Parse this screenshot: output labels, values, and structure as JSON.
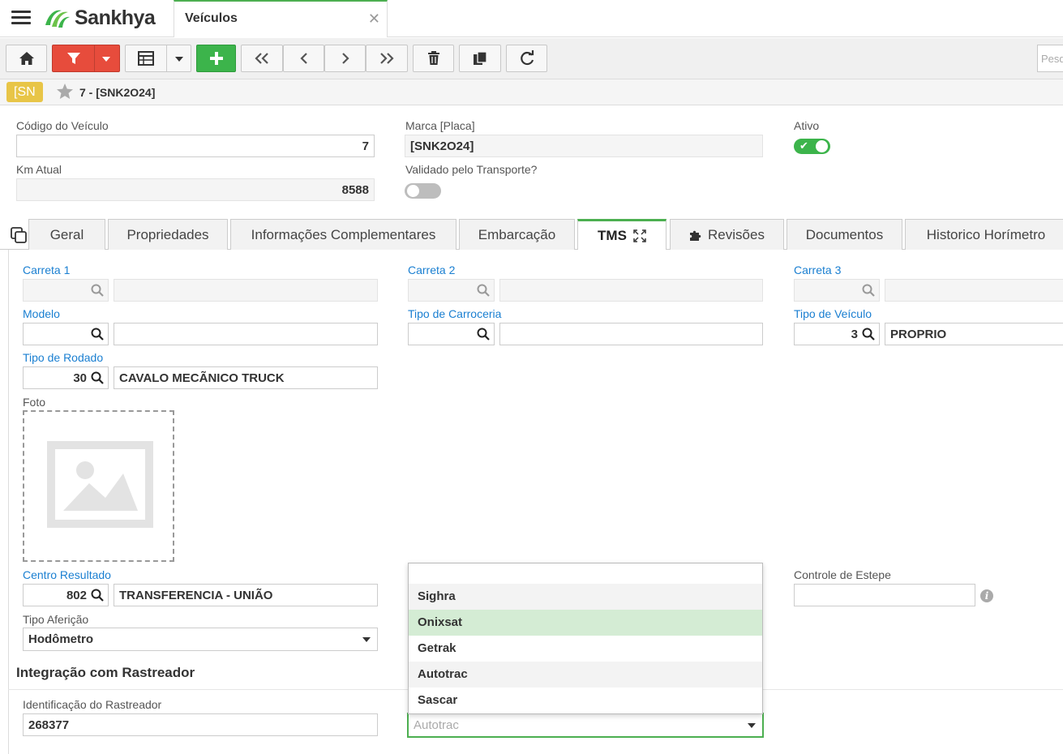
{
  "app": {
    "brand": "Sankhya",
    "open_tab": "Veículos"
  },
  "toolbar": {
    "search_placeholder": "Pesq"
  },
  "breadcrumb": {
    "tag": "[SN",
    "title": "7 - [SNK2O24]"
  },
  "form": {
    "codigo_label": "Código do Veículo",
    "codigo_value": "7",
    "marca_label": "Marca [Placa]",
    "marca_value": "[SNK2O24]",
    "ativo_label": "Ativo",
    "ativo": true,
    "km_label": "Km Atual",
    "km_value": "8588",
    "validado_label": "Validado pelo Transporte?",
    "validado": false
  },
  "tabs": [
    {
      "label": "Geral"
    },
    {
      "label": "Propriedades"
    },
    {
      "label": "Informações Complementares"
    },
    {
      "label": "Embarcação"
    },
    {
      "label": "TMS",
      "active": true
    },
    {
      "label": "Revisões"
    },
    {
      "label": "Documentos"
    },
    {
      "label": "Historico Horímetro"
    }
  ],
  "tms": {
    "carreta1_label": "Carreta 1",
    "carreta1_code": "",
    "carreta1_desc": "",
    "carreta2_label": "Carreta 2",
    "carreta2_code": "",
    "carreta2_desc": "",
    "carreta3_label": "Carreta 3",
    "carreta3_code": "",
    "carreta3_desc": "",
    "modelo_label": "Modelo",
    "modelo_code": "",
    "modelo_desc": "",
    "tipo_carroceria_label": "Tipo de Carroceria",
    "tipo_carroceria_code": "",
    "tipo_carroceria_desc": "",
    "tipo_veiculo_label": "Tipo de Veículo",
    "tipo_veiculo_code": "3",
    "tipo_veiculo_desc": "PROPRIO",
    "tipo_rodado_label": "Tipo de Rodado",
    "tipo_rodado_code": "30",
    "tipo_rodado_desc": "CAVALO MECÃNICO TRUCK",
    "foto_label": "Foto",
    "centro_label": "Centro Resultado",
    "centro_code": "802",
    "centro_desc": "TRANSFERENCIA - UNIÃO",
    "tipo_afericao_label": "Tipo Aferição",
    "tipo_afericao_value": "Hodômetro",
    "estepe_label": "Controle de Estepe",
    "estepe_value": "",
    "integracao_title": "Integração com Rastreador",
    "id_rastreador_label": "Identificação do Rastreador",
    "id_rastreador_value": "268377",
    "rastreador_select_value": "Autotrac"
  },
  "dropdown": {
    "options": [
      "",
      "Sighra",
      "Onixsat",
      "Getrak",
      "Autotrac",
      "Sascar"
    ],
    "highlighted": "Onixsat"
  },
  "colors": {
    "accent_green": "#4caf50",
    "filter_red": "#e74c3c",
    "add_green": "#3cb44b",
    "label_blue": "#1a7fd1",
    "tag_yellow": "#e8c547"
  }
}
